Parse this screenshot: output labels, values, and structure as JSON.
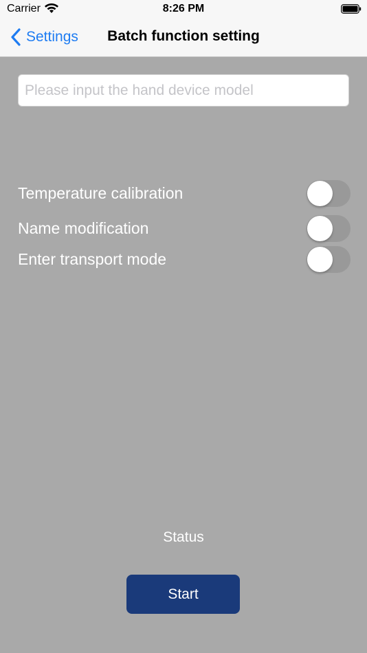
{
  "status_bar": {
    "carrier": "Carrier",
    "time": "8:26 PM"
  },
  "nav": {
    "back_label": "Settings",
    "title": "Batch function setting"
  },
  "model_input": {
    "value": "",
    "placeholder": "Please input the hand device model"
  },
  "settings": [
    {
      "label": "Temperature calibration",
      "enabled": false
    },
    {
      "label": "Name modification",
      "enabled": false
    },
    {
      "label": "Enter transport mode",
      "enabled": false
    }
  ],
  "status_text": "Status",
  "start_button": {
    "label": "Start"
  },
  "colors": {
    "accent": "#1e7cf2",
    "background": "#a9a9a9",
    "start_button": "#1a3a7a",
    "switch_off": "#999999"
  }
}
